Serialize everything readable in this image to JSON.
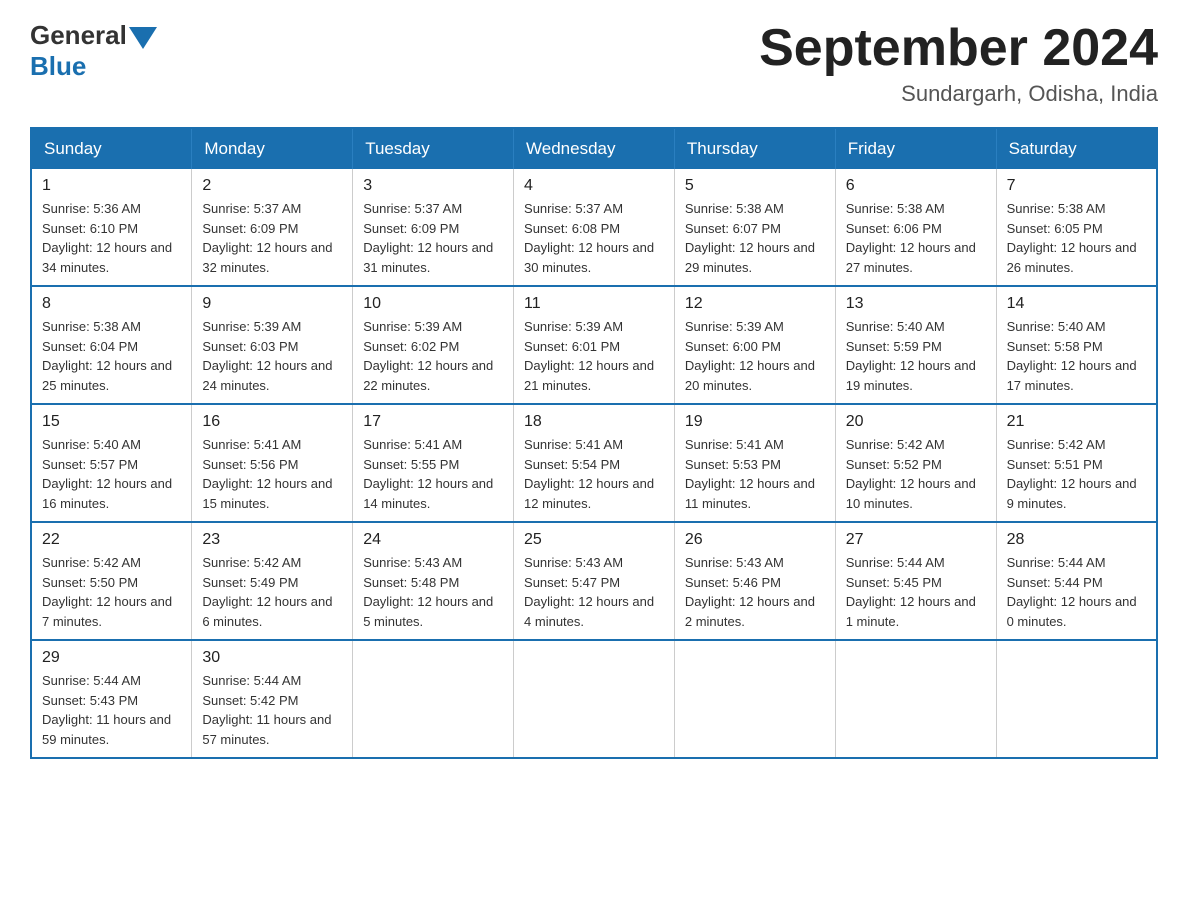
{
  "header": {
    "logo_general": "General",
    "logo_blue": "Blue",
    "month_year": "September 2024",
    "location": "Sundargarh, Odisha, India"
  },
  "days_of_week": [
    "Sunday",
    "Monday",
    "Tuesday",
    "Wednesday",
    "Thursday",
    "Friday",
    "Saturday"
  ],
  "weeks": [
    [
      {
        "day": "1",
        "sunrise": "5:36 AM",
        "sunset": "6:10 PM",
        "daylight": "12 hours and 34 minutes."
      },
      {
        "day": "2",
        "sunrise": "5:37 AM",
        "sunset": "6:09 PM",
        "daylight": "12 hours and 32 minutes."
      },
      {
        "day": "3",
        "sunrise": "5:37 AM",
        "sunset": "6:09 PM",
        "daylight": "12 hours and 31 minutes."
      },
      {
        "day": "4",
        "sunrise": "5:37 AM",
        "sunset": "6:08 PM",
        "daylight": "12 hours and 30 minutes."
      },
      {
        "day": "5",
        "sunrise": "5:38 AM",
        "sunset": "6:07 PM",
        "daylight": "12 hours and 29 minutes."
      },
      {
        "day": "6",
        "sunrise": "5:38 AM",
        "sunset": "6:06 PM",
        "daylight": "12 hours and 27 minutes."
      },
      {
        "day": "7",
        "sunrise": "5:38 AM",
        "sunset": "6:05 PM",
        "daylight": "12 hours and 26 minutes."
      }
    ],
    [
      {
        "day": "8",
        "sunrise": "5:38 AM",
        "sunset": "6:04 PM",
        "daylight": "12 hours and 25 minutes."
      },
      {
        "day": "9",
        "sunrise": "5:39 AM",
        "sunset": "6:03 PM",
        "daylight": "12 hours and 24 minutes."
      },
      {
        "day": "10",
        "sunrise": "5:39 AM",
        "sunset": "6:02 PM",
        "daylight": "12 hours and 22 minutes."
      },
      {
        "day": "11",
        "sunrise": "5:39 AM",
        "sunset": "6:01 PM",
        "daylight": "12 hours and 21 minutes."
      },
      {
        "day": "12",
        "sunrise": "5:39 AM",
        "sunset": "6:00 PM",
        "daylight": "12 hours and 20 minutes."
      },
      {
        "day": "13",
        "sunrise": "5:40 AM",
        "sunset": "5:59 PM",
        "daylight": "12 hours and 19 minutes."
      },
      {
        "day": "14",
        "sunrise": "5:40 AM",
        "sunset": "5:58 PM",
        "daylight": "12 hours and 17 minutes."
      }
    ],
    [
      {
        "day": "15",
        "sunrise": "5:40 AM",
        "sunset": "5:57 PM",
        "daylight": "12 hours and 16 minutes."
      },
      {
        "day": "16",
        "sunrise": "5:41 AM",
        "sunset": "5:56 PM",
        "daylight": "12 hours and 15 minutes."
      },
      {
        "day": "17",
        "sunrise": "5:41 AM",
        "sunset": "5:55 PM",
        "daylight": "12 hours and 14 minutes."
      },
      {
        "day": "18",
        "sunrise": "5:41 AM",
        "sunset": "5:54 PM",
        "daylight": "12 hours and 12 minutes."
      },
      {
        "day": "19",
        "sunrise": "5:41 AM",
        "sunset": "5:53 PM",
        "daylight": "12 hours and 11 minutes."
      },
      {
        "day": "20",
        "sunrise": "5:42 AM",
        "sunset": "5:52 PM",
        "daylight": "12 hours and 10 minutes."
      },
      {
        "day": "21",
        "sunrise": "5:42 AM",
        "sunset": "5:51 PM",
        "daylight": "12 hours and 9 minutes."
      }
    ],
    [
      {
        "day": "22",
        "sunrise": "5:42 AM",
        "sunset": "5:50 PM",
        "daylight": "12 hours and 7 minutes."
      },
      {
        "day": "23",
        "sunrise": "5:42 AM",
        "sunset": "5:49 PM",
        "daylight": "12 hours and 6 minutes."
      },
      {
        "day": "24",
        "sunrise": "5:43 AM",
        "sunset": "5:48 PM",
        "daylight": "12 hours and 5 minutes."
      },
      {
        "day": "25",
        "sunrise": "5:43 AM",
        "sunset": "5:47 PM",
        "daylight": "12 hours and 4 minutes."
      },
      {
        "day": "26",
        "sunrise": "5:43 AM",
        "sunset": "5:46 PM",
        "daylight": "12 hours and 2 minutes."
      },
      {
        "day": "27",
        "sunrise": "5:44 AM",
        "sunset": "5:45 PM",
        "daylight": "12 hours and 1 minute."
      },
      {
        "day": "28",
        "sunrise": "5:44 AM",
        "sunset": "5:44 PM",
        "daylight": "12 hours and 0 minutes."
      }
    ],
    [
      {
        "day": "29",
        "sunrise": "5:44 AM",
        "sunset": "5:43 PM",
        "daylight": "11 hours and 59 minutes."
      },
      {
        "day": "30",
        "sunrise": "5:44 AM",
        "sunset": "5:42 PM",
        "daylight": "11 hours and 57 minutes."
      },
      null,
      null,
      null,
      null,
      null
    ]
  ],
  "labels": {
    "sunrise": "Sunrise:",
    "sunset": "Sunset:",
    "daylight": "Daylight:"
  }
}
